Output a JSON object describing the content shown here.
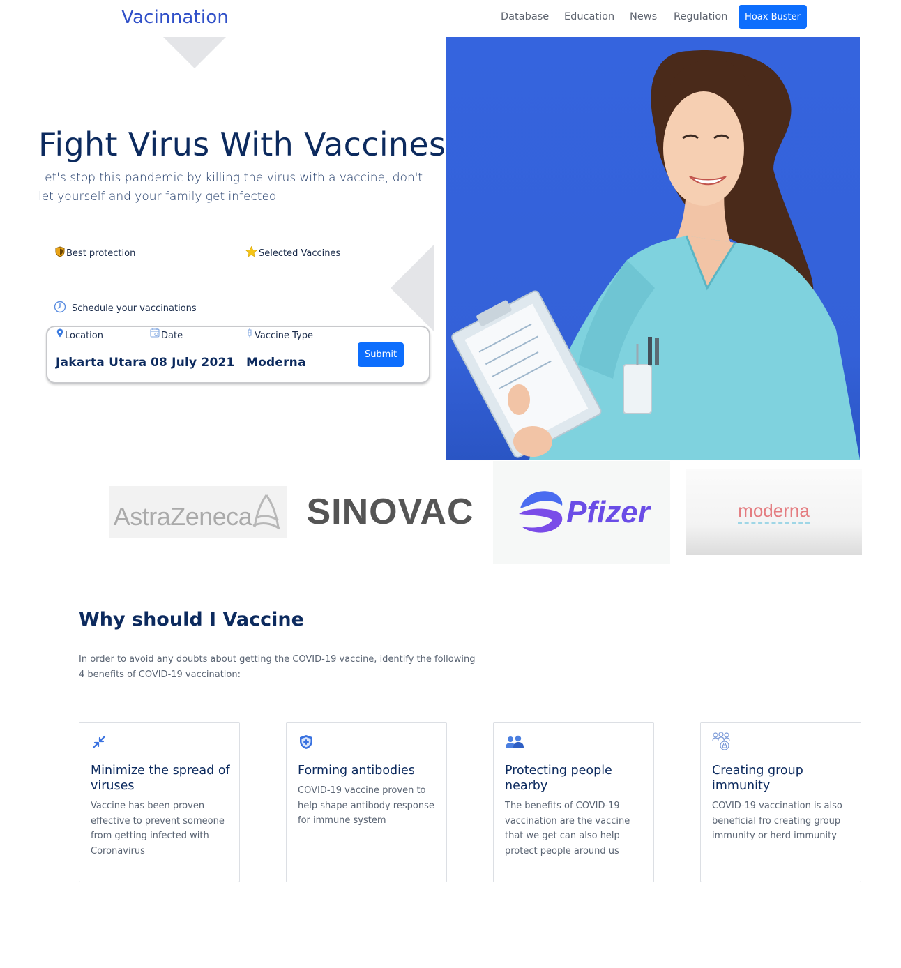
{
  "nav": {
    "brand": "Vacinnation",
    "links": [
      "Database",
      "Education",
      "News",
      "Regulation"
    ],
    "cta": "Hoax Buster"
  },
  "hero": {
    "title": "Fight Virus With Vaccines",
    "subtitle": "Let's stop this pandemic by killing the virus with a vaccine, don't let yourself and your family get infected",
    "features": [
      {
        "icon": "shield-icon",
        "label": "Best protection"
      },
      {
        "icon": "star-icon",
        "label": "Selected Vaccines"
      },
      {
        "icon": "clock-icon",
        "label": "Schedule your vaccinations"
      }
    ],
    "booking": {
      "location_label": "Location",
      "location_value": "Jakarta Utara",
      "date_label": "Date",
      "date_value": "08 July 2021",
      "type_label": "Vaccine Type",
      "type_value": "Moderna",
      "submit": "Submit"
    }
  },
  "brands": [
    "AstraZeneca",
    "SINOVAC",
    "Pfizer",
    "moderna"
  ],
  "why": {
    "title": "Why should I Vaccine",
    "description": "In order to avoid any doubts about getting the COVID-19 vaccine, identify the following 4 benefits of COVID-19 vaccination:",
    "cards": [
      {
        "icon": "compress-arrows-icon",
        "title": "Minimize the spread of viruses",
        "text": "Vaccine has been proven effective to prevent someone from getting infected with Coronavirus"
      },
      {
        "icon": "shield-plus-icon",
        "title": "Forming antibodies",
        "text": "COVID-19 vaccine proven to help shape antibody response for immune system"
      },
      {
        "icon": "people-icon",
        "title": "Protecting people nearby",
        "text": "The benefits of COVID-19 vaccination are the vaccine that we get can also help protect people around us"
      },
      {
        "icon": "group-lock-icon",
        "title": "Creating group immunity",
        "text": "COVID-19 vaccination is also beneficial fro creating group immunity or herd immunity"
      }
    ]
  },
  "colors": {
    "primary": "#0d6efd",
    "brand": "#3050c8",
    "heading": "#0c2a5e",
    "hero_bg": "#3564de"
  }
}
